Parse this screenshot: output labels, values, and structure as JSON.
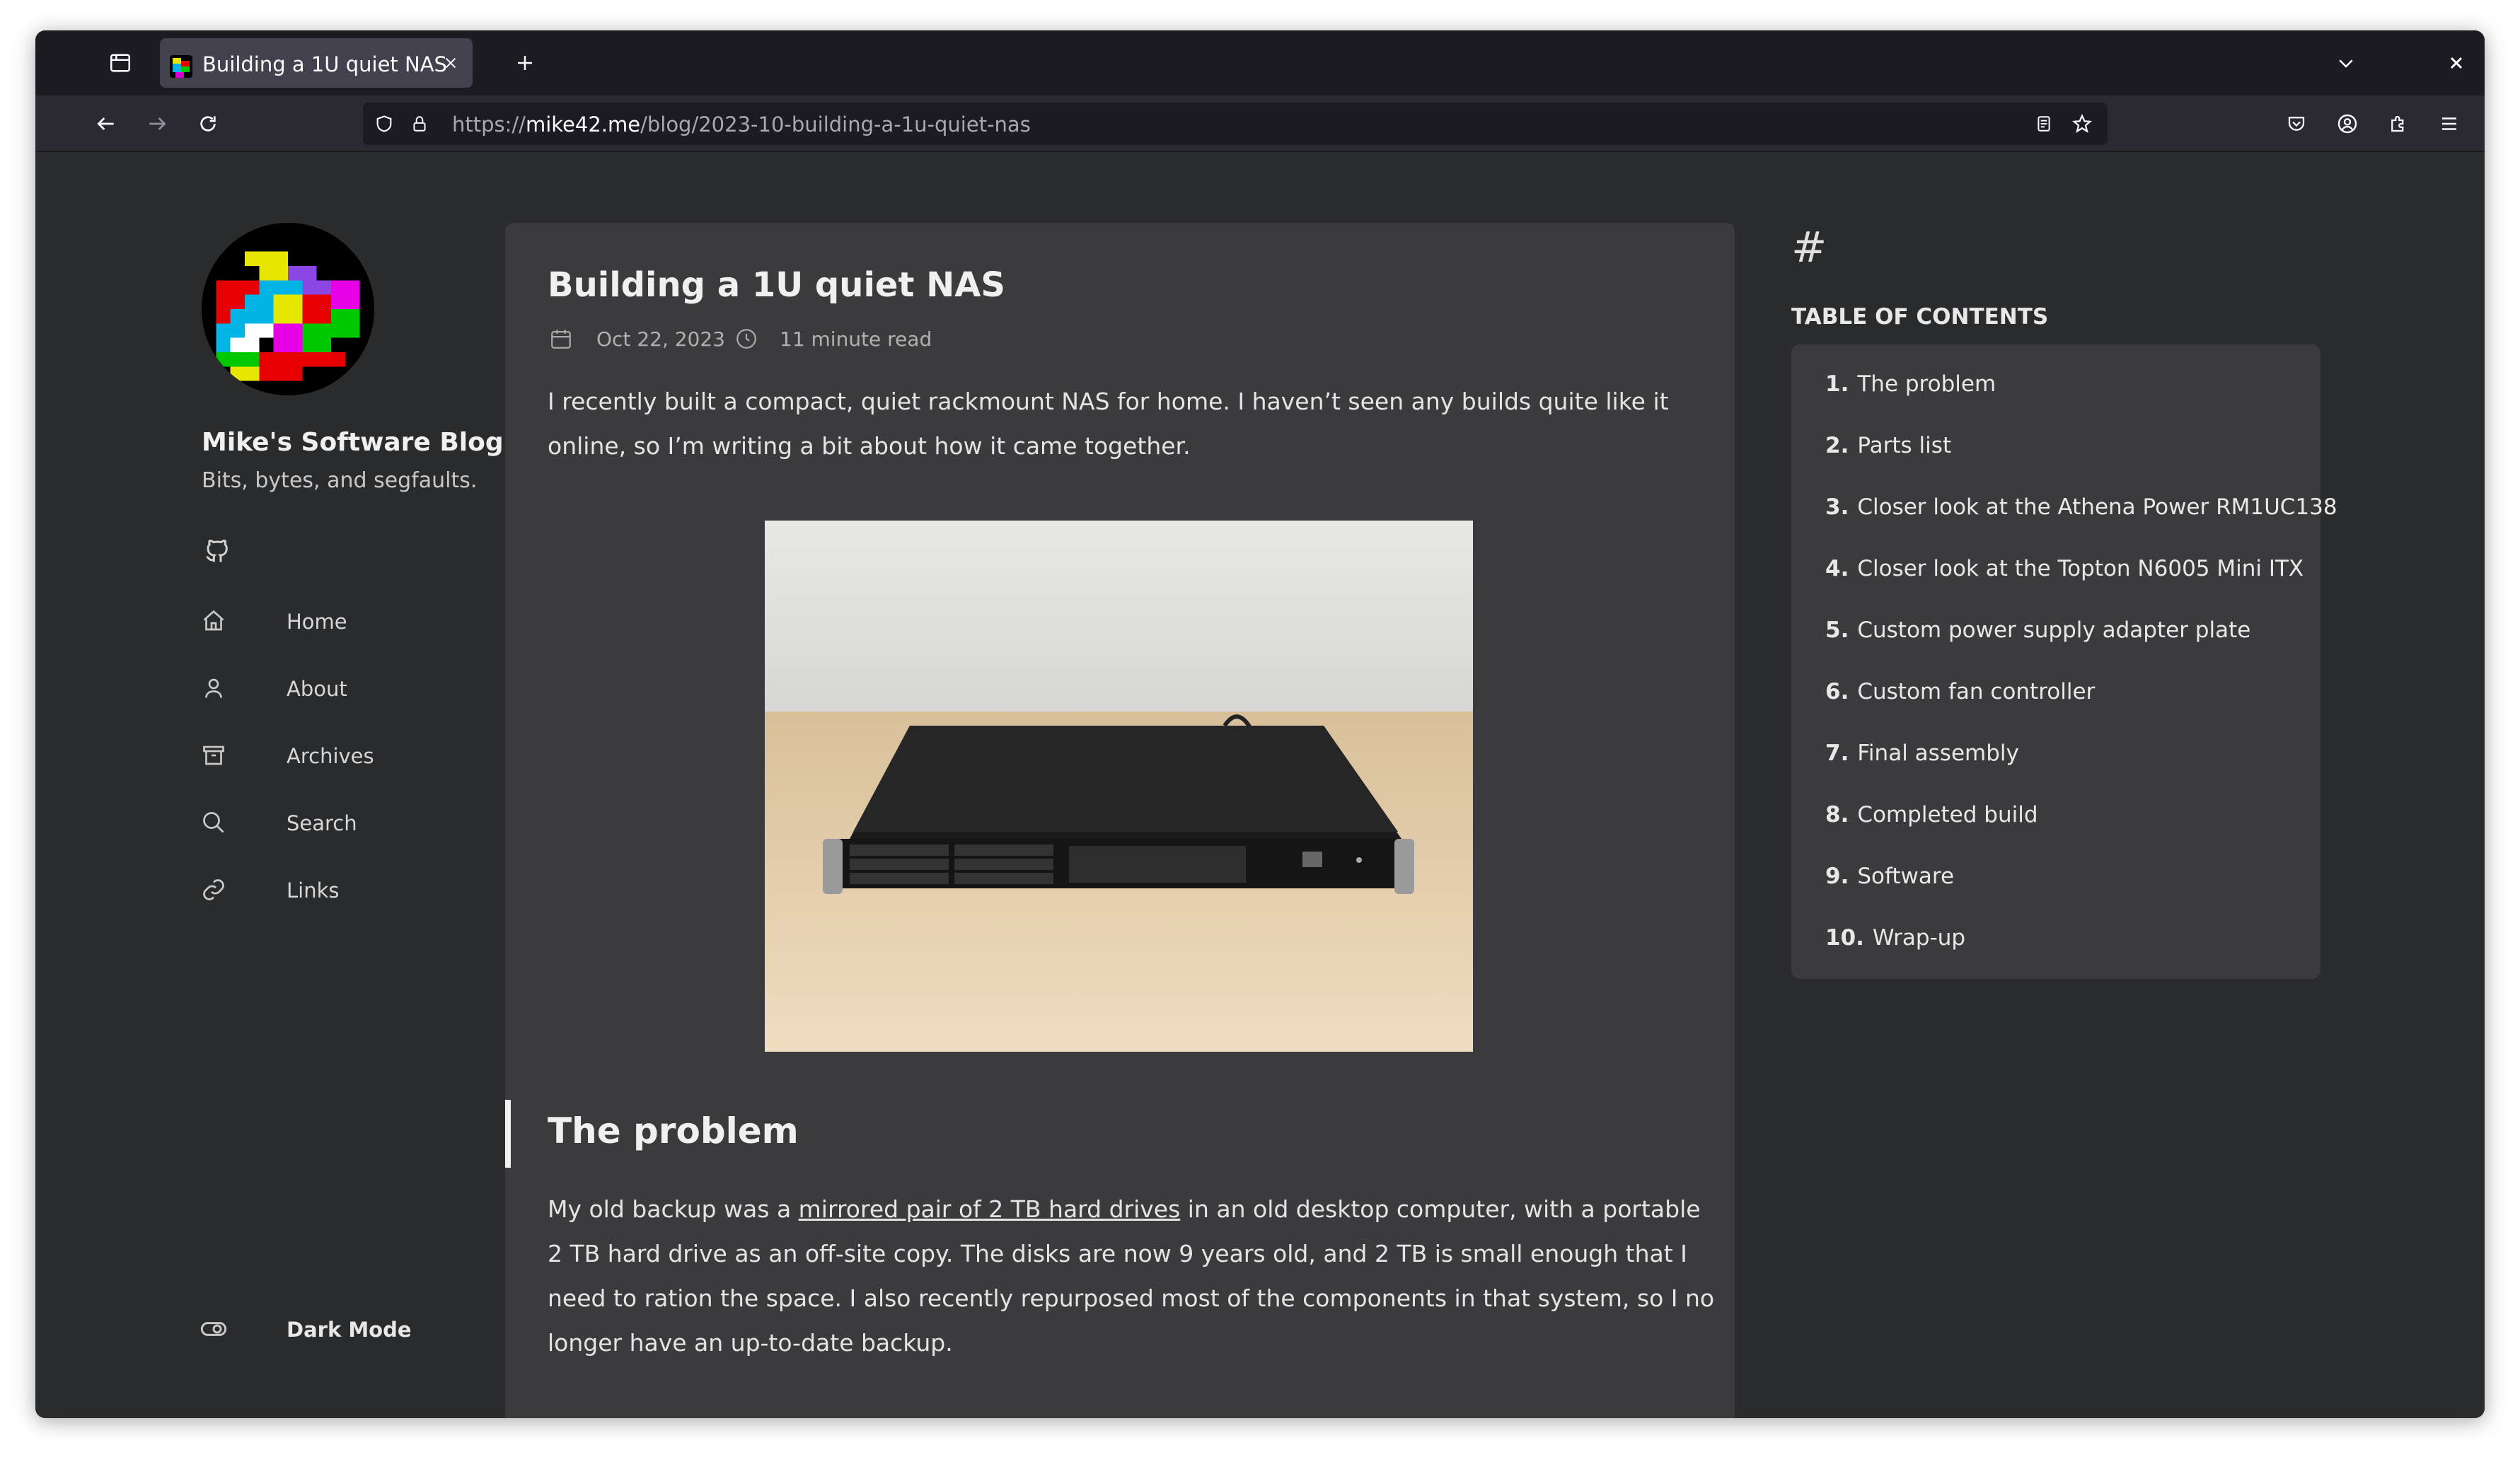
{
  "browser": {
    "tab": {
      "title": "Building a 1U quiet NAS"
    },
    "url": {
      "prefix": "https://",
      "host": "mike42.me",
      "path": "/blog/2023-10-building-a-1u-quiet-nas"
    }
  },
  "sidebar": {
    "site_title": "Mike's Software Blog",
    "subtitle": "Bits, bytes, and segfaults.",
    "menu": [
      {
        "label": "Home",
        "icon": "home-icon"
      },
      {
        "label": "About",
        "icon": "person-icon"
      },
      {
        "label": "Archives",
        "icon": "archive-icon"
      },
      {
        "label": "Search",
        "icon": "search-icon"
      },
      {
        "label": "Links",
        "icon": "link-icon"
      }
    ],
    "dark_mode_label": "Dark Mode"
  },
  "article": {
    "title": "Building a 1U quiet NAS",
    "date": "Oct 22, 2023",
    "read_time": "11 minute read",
    "intro": "I recently built a compact, quiet rackmount NAS for home. I haven’t seen any builds quite like it online, so I’m writing a bit about how it came together.",
    "section_heading": "The problem",
    "problem_text_before": "My old backup was a ",
    "problem_link": "mirrored pair of 2 TB hard drives",
    "problem_text_after": " in an old desktop computer, with a portable 2 TB hard drive as an off-site copy. The disks are now 9 years old, and 2 TB is small enough that I need to ration the space. I also recently repurposed most of the components in that system, so I no longer have an up-to-date backup."
  },
  "toc": {
    "symbol": "#",
    "heading": "TABLE OF CONTENTS",
    "items": [
      {
        "num": "1.",
        "label": "The problem"
      },
      {
        "num": "2.",
        "label": "Parts list"
      },
      {
        "num": "3.",
        "label": "Closer look at the Athena Power RM1UC138"
      },
      {
        "num": "4.",
        "label": "Closer look at the Topton N6005 Mini ITX"
      },
      {
        "num": "5.",
        "label": "Custom power supply adapter plate"
      },
      {
        "num": "6.",
        "label": "Custom fan controller"
      },
      {
        "num": "7.",
        "label": "Final assembly"
      },
      {
        "num": "8.",
        "label": "Completed build"
      },
      {
        "num": "9.",
        "label": "Software"
      },
      {
        "num": "10.",
        "label": "Wrap-up"
      }
    ]
  }
}
